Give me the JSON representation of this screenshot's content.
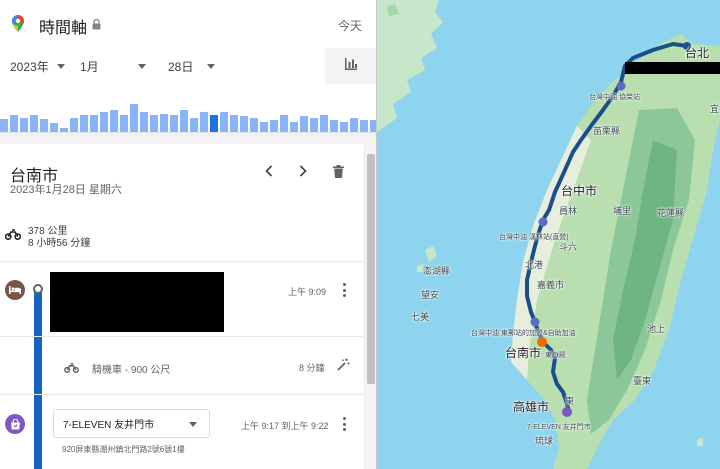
{
  "app": {
    "title": "時間軸",
    "today_label": "今天",
    "accent": "#1a73e8"
  },
  "date_picker": {
    "year": "2023年",
    "month": "1月",
    "day": "28日"
  },
  "day": {
    "title": "台南市",
    "date": "2023年1月28日 星期六",
    "distance": "378 公里",
    "duration": "8 小時56 分鐘"
  },
  "entries": {
    "first": {
      "time": "上午 9:09"
    },
    "ride": {
      "label": "騎機車 - 900 公尺",
      "duration": "8 分鐘"
    },
    "place": {
      "name": "7-ELEVEN 友井門市",
      "time": "上午 9:17 到上午 9:22",
      "address": "920屏東縣潮州鎮北門路2號6號1樓"
    }
  },
  "histogram": {
    "selected_index": 21,
    "values": [
      0.32,
      0.42,
      0.34,
      0.42,
      0.32,
      0.22,
      0.1,
      0.34,
      0.42,
      0.42,
      0.5,
      0.56,
      0.42,
      0.7,
      0.5,
      0.42,
      0.46,
      0.42,
      0.54,
      0.34,
      0.5,
      0.42,
      0.5,
      0.42,
      0.4,
      0.34,
      0.24,
      0.3,
      0.42,
      0.24,
      0.4,
      0.34,
      0.42,
      0.3,
      0.24,
      0.34,
      0.3,
      0.3,
      0.24,
      0.34,
      0.3,
      0.26,
      0.34,
      0.3,
      0.34,
      0.26,
      0.3,
      0.34,
      0.3,
      0.26,
      0.34,
      0.3,
      0.3,
      0.34,
      0.26,
      0.3,
      0.34,
      0.26
    ]
  },
  "icons": {
    "pin": "maps-pin-icon",
    "lock": "lock-icon",
    "chart": "bar-chart-icon",
    "prev": "chevron-left-icon",
    "next": "chevron-right-icon",
    "delete": "trash-icon",
    "motorcycle": "motorcycle-icon",
    "hotel": "hotel-icon",
    "store": "store-icon",
    "more": "more-vert-icon",
    "wand": "magic-wand-icon"
  },
  "map": {
    "labels": {
      "taipei": "台北",
      "taoyuan_station": "台灣中油 協榮站",
      "miaoli": "苗栗縣",
      "taichung": "台中市",
      "yuanlin": "員林",
      "puli": "埔里",
      "hualien": "花蓮縣",
      "station2": "台灣中油 漢林站(直營)",
      "douliu": "斗六",
      "beigang": "北港",
      "penghu": "澎湖縣",
      "wangan": "望安",
      "qimei": "七美",
      "chiayi": "嘉義市",
      "station3": "台灣中油 東郵站的加盟&自助加油",
      "tainan": "台南市",
      "shrine": "東嶽殿",
      "chishang": "池上",
      "taitung": "臺東",
      "kaohsiung": "高雄市",
      "dongli": "東",
      "store": "7-ELEVEN 友井門市",
      "liuqiu": "琉球",
      "yilan": "宜"
    }
  }
}
